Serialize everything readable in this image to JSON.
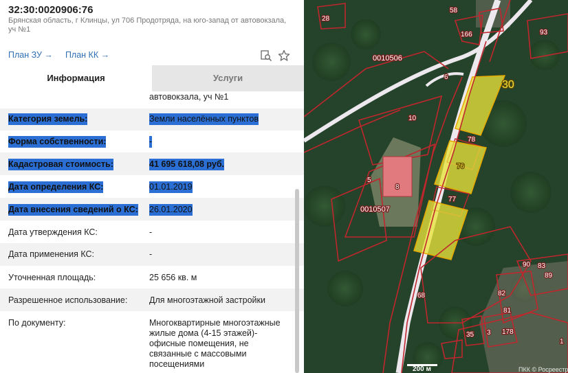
{
  "header": {
    "cadastral_number": "32:30:0020906:76",
    "address": "Брянская область, г Клинцы, ул 706 Продотряда, на юго-запад от автовокзала, уч №1"
  },
  "links": {
    "plan_zu": "План ЗУ →",
    "plan_kk": "План КК →"
  },
  "icons": {
    "search": "search-document-icon",
    "favorite": "star-icon"
  },
  "tabs": [
    {
      "label": "Информация",
      "active": true
    },
    {
      "label": "Услуги",
      "active": false
    }
  ],
  "info": {
    "address_tail": "автовокзала, уч №1",
    "rows": [
      {
        "label": "Категория земель:",
        "value": "Земли населённых пунктов",
        "selected": true
      },
      {
        "label": "Форма собственности:",
        "value": "-",
        "selected": true
      },
      {
        "label": "Кадастровая стоимость:",
        "value": "41 695 618,08 руб.",
        "selected": true
      },
      {
        "label": "Дата определения КС:",
        "value": "01.01.2019",
        "selected": true
      },
      {
        "label": "Дата внесения сведений о КС:",
        "value": "26.01.2020",
        "selected": true
      },
      {
        "label": "Дата утверждения КС:",
        "value": "-",
        "selected": false
      },
      {
        "label": "Дата применения КС:",
        "value": "-",
        "selected": false
      },
      {
        "label": "Уточненная площадь:",
        "value": "25 656 кв. м",
        "selected": false
      },
      {
        "label": "Разрешенное использование:",
        "value": "Для многоэтажной застройки",
        "selected": false
      },
      {
        "label": "По документу:",
        "value": "Многоквартирные многоэтажные жилые дома (4-15 этажей)- офисные помещения, не связанные с массовыми посещениями",
        "selected": false
      }
    ]
  },
  "map": {
    "quarter_labels": [
      "0010506",
      "0010507"
    ],
    "parcel_labels": [
      "28",
      "58",
      "166",
      "93",
      "6",
      "30",
      "10",
      "78",
      "76",
      "5",
      "8",
      "77",
      "68",
      "90",
      "83",
      "89",
      "82",
      "81",
      "35",
      "3",
      "178",
      "1"
    ],
    "scale": "200 м",
    "attribution": "ПКК © Росреестр",
    "colors": {
      "selected_parcel": "#e8e43a",
      "boundary": "#c0262d",
      "road": "#ece8ee"
    }
  }
}
